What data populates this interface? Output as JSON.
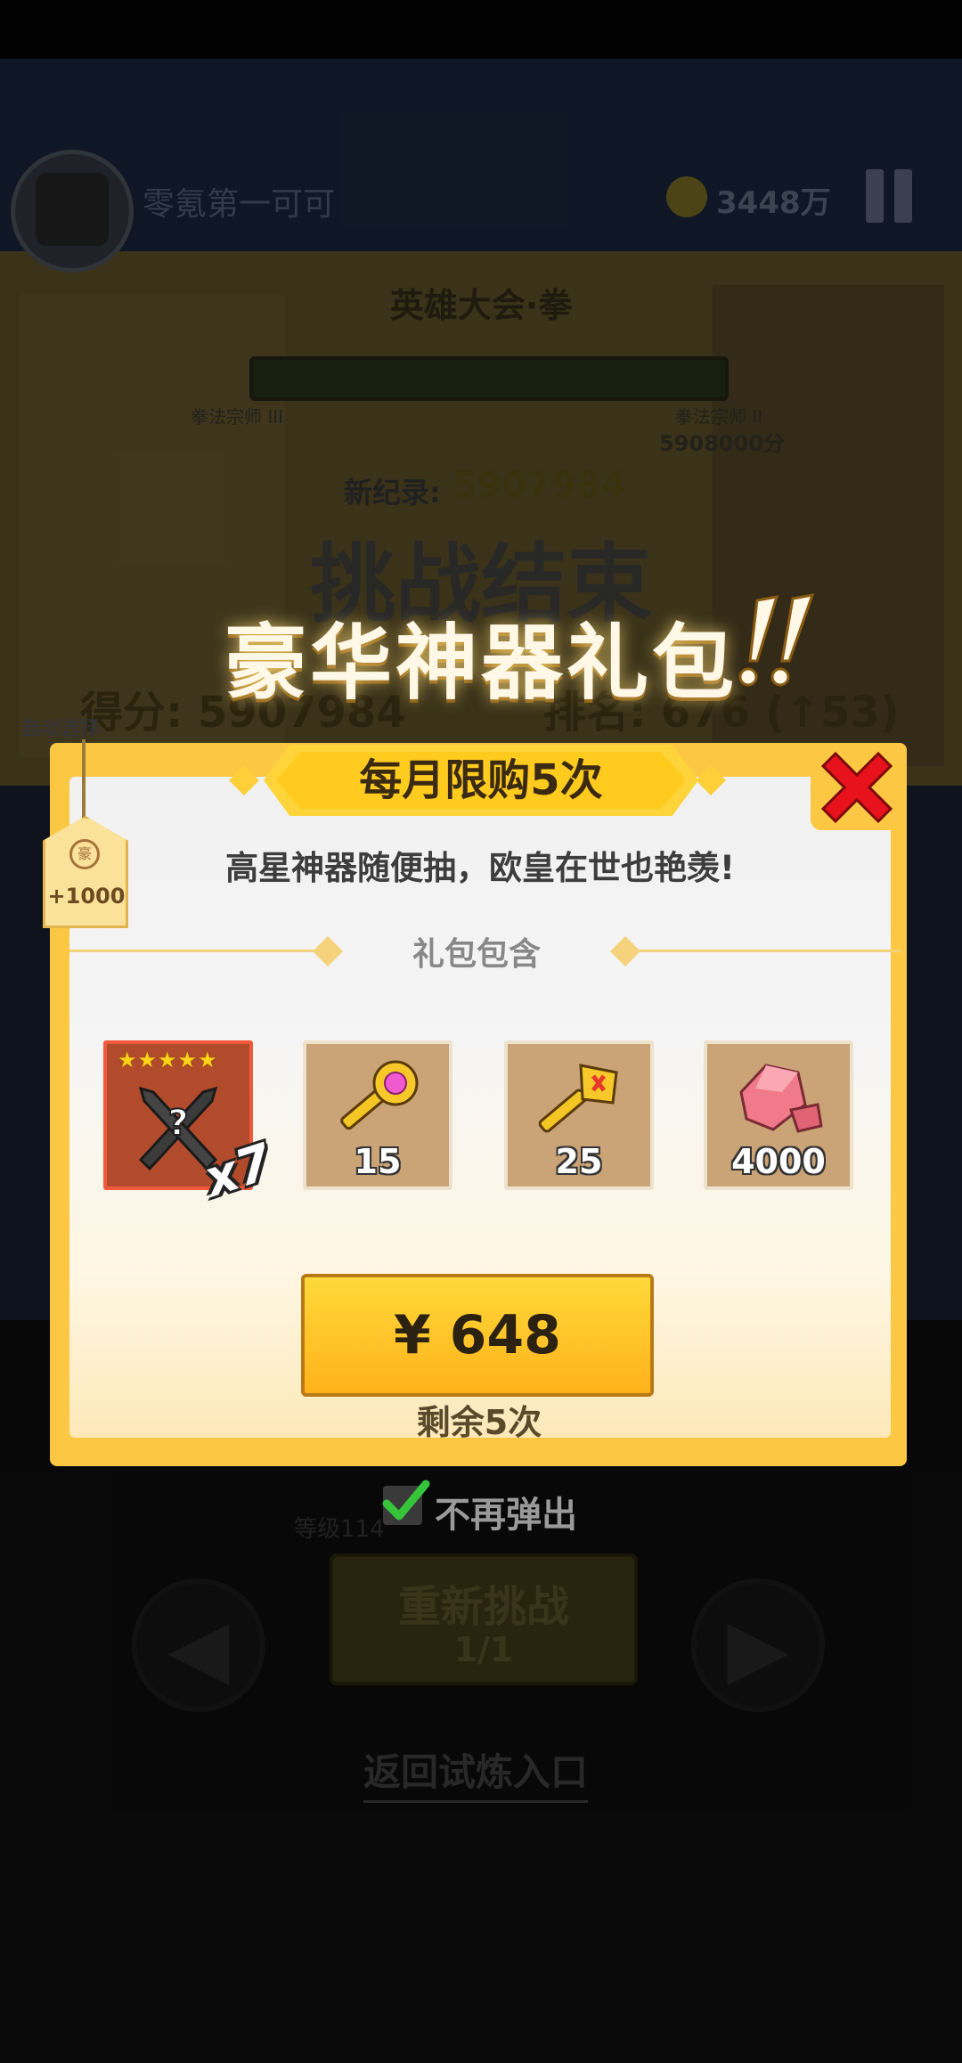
{
  "background": {
    "player_name": "零氪第一可可",
    "coins": "3448万",
    "event_title": "英雄大会·拳",
    "rank_left": "拳法宗师 III",
    "rank_right": "拳法宗师 II",
    "rank_right_score": "5908000分",
    "record_label": "新纪录:",
    "record_value": "5907984",
    "challenge_end": "挑战结束",
    "auto_select": "自动选择",
    "score_text": "得分: 5907984",
    "rank_text": "排名: 676 (↑53)",
    "level_text": "等级114",
    "retry_label": "重新挑战",
    "retry_count": "1/1",
    "back_link": "返回试炼入口"
  },
  "banner": {
    "title": "豪华神器礼包"
  },
  "dialog": {
    "header": "每月限购5次",
    "subtitle": "高星神器随便抽，欧皇在世也艳羡!",
    "section_label": "礼包包含",
    "tag_icon_text": "豪",
    "tag_value": "+1000",
    "items": [
      {
        "name": "artifact",
        "stars": "★★★★★",
        "multiplier": "x7"
      },
      {
        "name": "pink-key",
        "quantity": "15"
      },
      {
        "name": "gold-key",
        "quantity": "25"
      },
      {
        "name": "gem",
        "quantity": "4000"
      }
    ],
    "buy_price": "¥ 648",
    "remaining": "剩余5次",
    "no_popup": "不再弹出"
  },
  "colors": {
    "dialog_frame": "#fcc843",
    "buy_button": "#ffc72a",
    "close_x": "#e8121c",
    "check": "#35c43a"
  }
}
